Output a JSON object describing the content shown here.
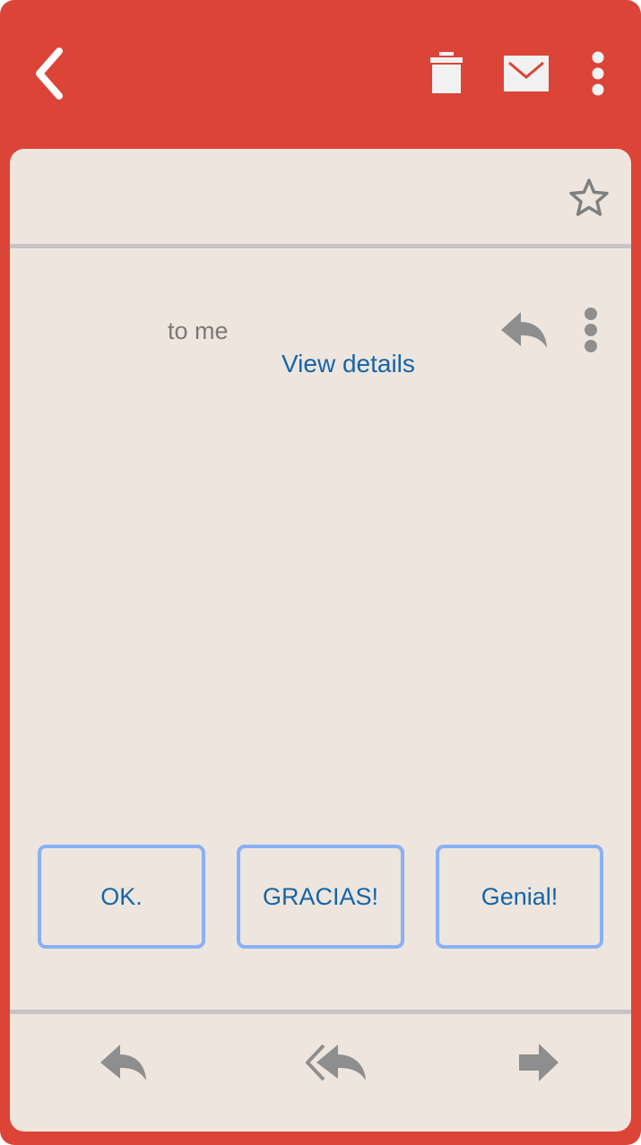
{
  "header": {
    "back_icon": "chevron-left-icon",
    "actions": [
      "trash-icon",
      "mail-icon",
      "more-vertical-icon"
    ]
  },
  "message": {
    "recipient_text": "to me",
    "view_details_label": "View details"
  },
  "smart_replies": [
    {
      "label": "OK."
    },
    {
      "label": "GRACIAS!"
    },
    {
      "label": "Genial!"
    }
  ],
  "bottom_actions": [
    "reply-icon",
    "reply-all-icon",
    "forward-icon"
  ],
  "colors": {
    "primary": "#DB4437",
    "card_background": "#EEE6DE",
    "link": "#1565A8",
    "icon_gray": "#8E8E8E",
    "chip_border": "#8AB0F7"
  }
}
